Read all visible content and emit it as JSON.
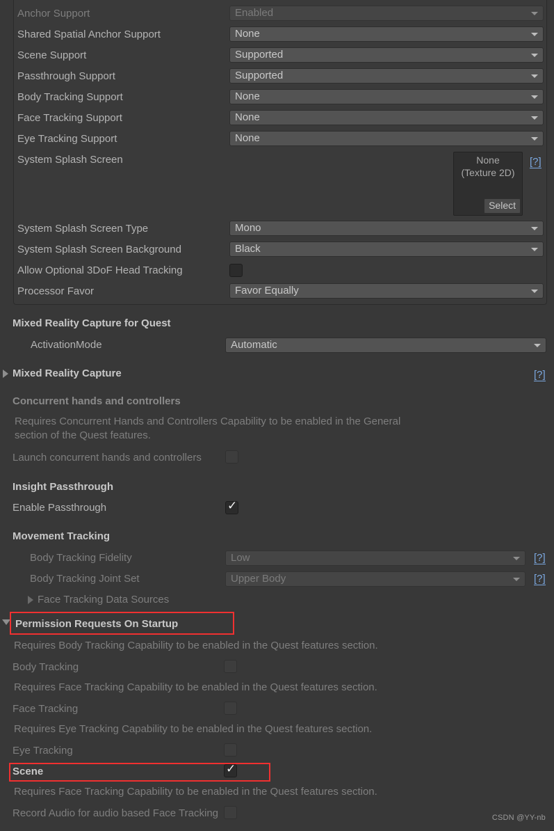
{
  "top_group": {
    "rows": [
      {
        "label": "Anchor Support",
        "value": "Enabled",
        "disabled": true
      },
      {
        "label": "Shared Spatial Anchor Support",
        "value": "None",
        "disabled": false
      },
      {
        "label": "Scene Support",
        "value": "Supported",
        "disabled": false
      },
      {
        "label": "Passthrough Support",
        "value": "Supported",
        "disabled": false
      },
      {
        "label": "Body Tracking Support",
        "value": "None",
        "disabled": false
      },
      {
        "label": "Face Tracking Support",
        "value": "None",
        "disabled": false
      },
      {
        "label": "Eye Tracking Support",
        "value": "None",
        "disabled": false
      }
    ],
    "splash": {
      "label": "System Splash Screen",
      "object_none": "None",
      "object_type": "(Texture 2D)",
      "select_label": "Select",
      "help": "[?]"
    },
    "splash_type": {
      "label": "System Splash Screen Type",
      "value": "Mono"
    },
    "splash_bg": {
      "label": "System Splash Screen Background",
      "value": "Black"
    },
    "head_tracking": {
      "label": "Allow Optional 3DoF Head Tracking",
      "checked": false
    },
    "processor_favor": {
      "label": "Processor Favor",
      "value": "Favor Equally"
    }
  },
  "mrc_quest": {
    "heading": "Mixed Reality Capture for Quest",
    "activation_label": "ActivationMode",
    "activation_value": "Automatic"
  },
  "mrc_foldout": {
    "label": "Mixed Reality Capture",
    "help": "[?]"
  },
  "concurrent": {
    "heading": "Concurrent hands and controllers",
    "note_line1": "Requires Concurrent Hands and Controllers Capability to be enabled in the General",
    "note_line2": "section of the Quest features.",
    "toggle_label": "Launch concurrent hands and controllers",
    "toggle_checked": false
  },
  "insight": {
    "heading": "Insight Passthrough",
    "toggle_label": "Enable Passthrough",
    "toggle_checked": true
  },
  "movement": {
    "heading": "Movement Tracking",
    "fidelity_label": "Body Tracking Fidelity",
    "fidelity_value": "Low",
    "fidelity_help": "[?]",
    "jointset_label": "Body Tracking Joint Set",
    "jointset_value": "Upper Body",
    "jointset_help": "[?]",
    "face_sources_label": "Face Tracking Data Sources"
  },
  "permissions": {
    "heading": "Permission Requests On Startup",
    "items": [
      {
        "note": "Requires Body Tracking Capability to be enabled in the Quest features section.",
        "label": "Body Tracking",
        "checked": false,
        "highlighted": false
      },
      {
        "note": "Requires Face Tracking Capability to be enabled in the Quest features section.",
        "label": "Face Tracking",
        "checked": false,
        "highlighted": false
      },
      {
        "note": "Requires Eye Tracking Capability to be enabled in the Quest features section.",
        "label": "Eye Tracking",
        "checked": false,
        "highlighted": false
      },
      {
        "note": "Requires Face Tracking Capability to be enabled in the Quest features section.",
        "label": "Scene",
        "checked": true,
        "highlighted": true
      },
      {
        "note": "",
        "label": "Record Audio for audio based Face Tracking",
        "checked": false,
        "highlighted": false
      }
    ]
  },
  "watermark": "CSDN @YY-nb",
  "colors": {
    "background": "#383838",
    "panel": "#3a3a3a",
    "dropdown": "#535353",
    "text": "#b4b4b4",
    "text_dim": "#7e7e7e",
    "accent_link": "#7ba7de",
    "annotation_red": "#f03030"
  }
}
